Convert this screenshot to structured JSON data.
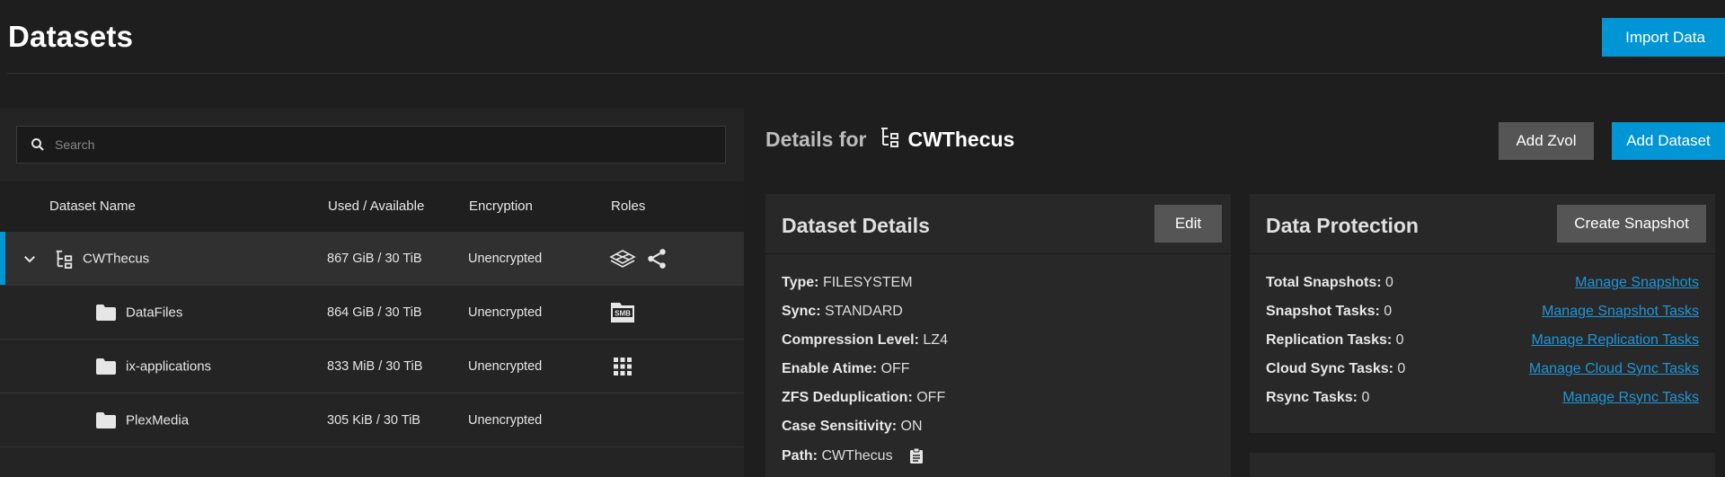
{
  "page": {
    "title": "Datasets",
    "import_button": "Import Data"
  },
  "search": {
    "placeholder": "Search"
  },
  "table": {
    "headers": [
      "Dataset Name",
      "Used / Available",
      "Encryption",
      "Roles"
    ],
    "rows": [
      {
        "name": "CWThecus",
        "usage": "867 GiB / 30 TiB",
        "encryption": "Unencrypted",
        "roles": [
          "dataset-role-icon",
          "share-icon"
        ]
      },
      {
        "name": "DataFiles",
        "usage": "864 GiB / 30 TiB",
        "encryption": "Unencrypted",
        "roles": [
          "smb-share-icon"
        ]
      },
      {
        "name": "ix-applications",
        "usage": "833 MiB / 30 TiB",
        "encryption": "Unencrypted",
        "roles": [
          "apps-grid-icon"
        ]
      },
      {
        "name": "PlexMedia",
        "usage": "305 KiB / 30 TiB",
        "encryption": "Unencrypted",
        "roles": []
      }
    ]
  },
  "details": {
    "label": "Details for",
    "dataset": "CWThecus",
    "add_zvol": "Add Zvol",
    "add_dataset": "Add Dataset"
  },
  "dataset_details": {
    "title": "Dataset Details",
    "edit": "Edit",
    "fields": [
      {
        "k": "Type:",
        "v": "FILESYSTEM"
      },
      {
        "k": "Sync:",
        "v": "STANDARD"
      },
      {
        "k": "Compression Level:",
        "v": "LZ4"
      },
      {
        "k": "Enable Atime:",
        "v": "OFF"
      },
      {
        "k": "ZFS Deduplication:",
        "v": "OFF"
      },
      {
        "k": "Case Sensitivity:",
        "v": "ON"
      },
      {
        "k": "Path:",
        "v": "CWThecus"
      }
    ]
  },
  "data_protection": {
    "title": "Data Protection",
    "create_snapshot": "Create Snapshot",
    "items": [
      {
        "k": "Total Snapshots:",
        "v": "0",
        "link": "Manage Snapshots"
      },
      {
        "k": "Snapshot Tasks:",
        "v": "0",
        "link": "Manage Snapshot Tasks"
      },
      {
        "k": "Replication Tasks:",
        "v": "0",
        "link": "Manage Replication Tasks"
      },
      {
        "k": "Cloud Sync Tasks:",
        "v": "0",
        "link": "Manage Cloud Sync Tasks"
      },
      {
        "k": "Rsync Tasks:",
        "v": "0",
        "link": "Manage Rsync Tasks"
      }
    ]
  },
  "colors": {
    "accent": "#0095d5",
    "link": "#1e96d8",
    "background": "#1e1e1e"
  }
}
